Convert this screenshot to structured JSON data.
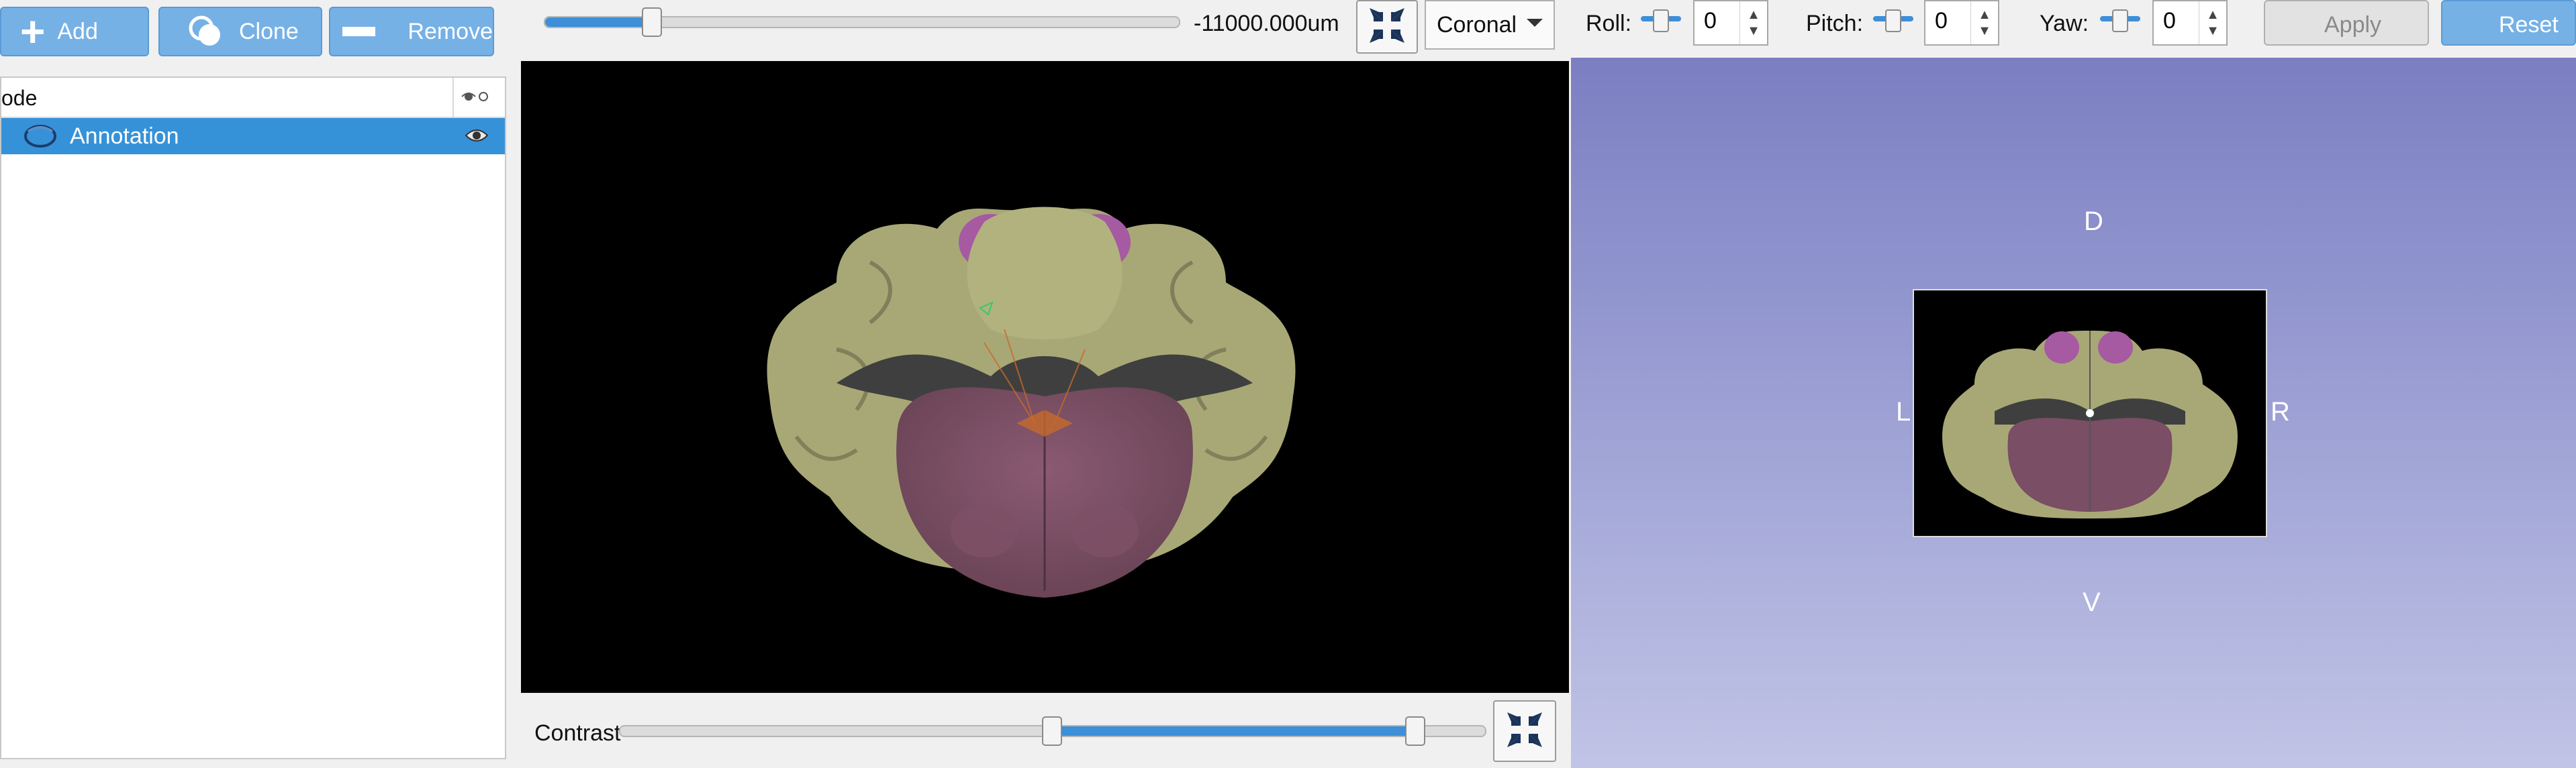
{
  "toolbar": {
    "add_label": "Add",
    "clone_label": "Clone",
    "remove_label": "Remove"
  },
  "tree": {
    "header_label": "ode",
    "row_label": "Annotation"
  },
  "slice": {
    "position_label": "-11000.000um",
    "position_fraction": 0.17,
    "orientation": "Coronal"
  },
  "rotation": {
    "roll_label": "Roll:",
    "roll_value": "0",
    "pitch_label": "Pitch:",
    "pitch_value": "0",
    "yaw_label": "Yaw:",
    "yaw_value": "0",
    "apply_label": "Apply",
    "reset_label": "Reset"
  },
  "contrast": {
    "label": "Contrast",
    "low_fraction": 0.5,
    "high_fraction": 0.92
  },
  "view3d": {
    "dorsal": "D",
    "ventral": "V",
    "left": "L",
    "right": "R"
  },
  "colors": {
    "accent": "#3c8fd8",
    "selection": "#3692d8",
    "button": "#76b1e6",
    "tissue": "#b8b87a",
    "highlight": "#b060b0"
  },
  "icons": {
    "add": "plus-icon",
    "clone": "clone-icon",
    "remove": "minus-icon",
    "visibility": "eye-icon",
    "fit": "fit-view-icon"
  }
}
